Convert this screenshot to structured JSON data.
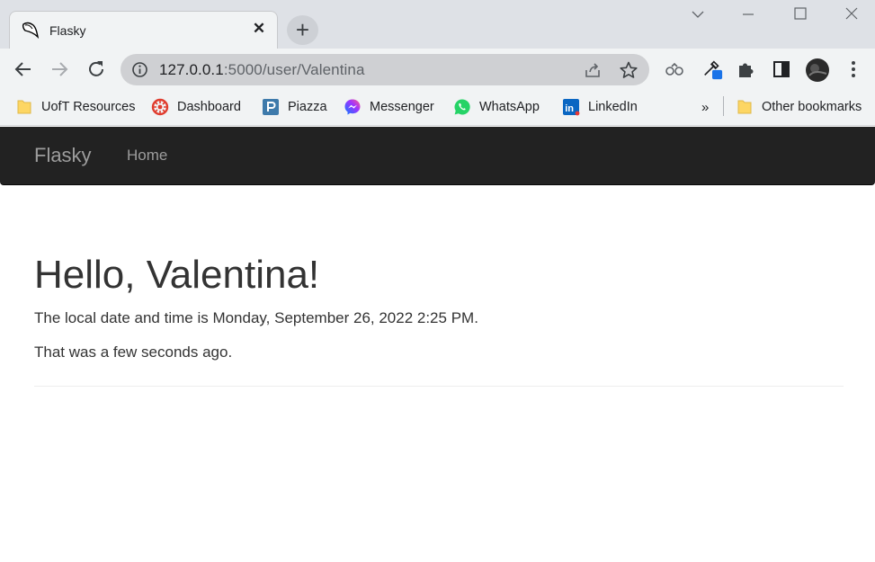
{
  "browser": {
    "tab": {
      "title": "Flasky",
      "favicon": "flask-horn-icon"
    },
    "address": {
      "host": "127.0.0.1",
      "path": ":5000/user/Valentina"
    },
    "bookmarks": [
      {
        "label": "UofT Resources",
        "icon": "folder-icon"
      },
      {
        "label": "Dashboard",
        "icon": "dashboard-icon"
      },
      {
        "label": "Piazza",
        "icon": "piazza-icon"
      },
      {
        "label": "Messenger",
        "icon": "messenger-icon"
      },
      {
        "label": "WhatsApp",
        "icon": "whatsapp-icon"
      },
      {
        "label": "LinkedIn",
        "icon": "linkedin-icon"
      }
    ],
    "bookmarks_overflow": "»",
    "other_bookmarks": "Other bookmarks"
  },
  "navbar": {
    "brand": "Flasky",
    "links": [
      "Home"
    ]
  },
  "page": {
    "heading": "Hello, Valentina!",
    "datetime_line": "The local date and time is Monday, September 26, 2022 2:25 PM.",
    "relative_line": "That was a few seconds ago."
  },
  "colors": {
    "navbar_bg": "#222222",
    "navbar_text": "#9d9d9d",
    "body_text": "#333333"
  }
}
